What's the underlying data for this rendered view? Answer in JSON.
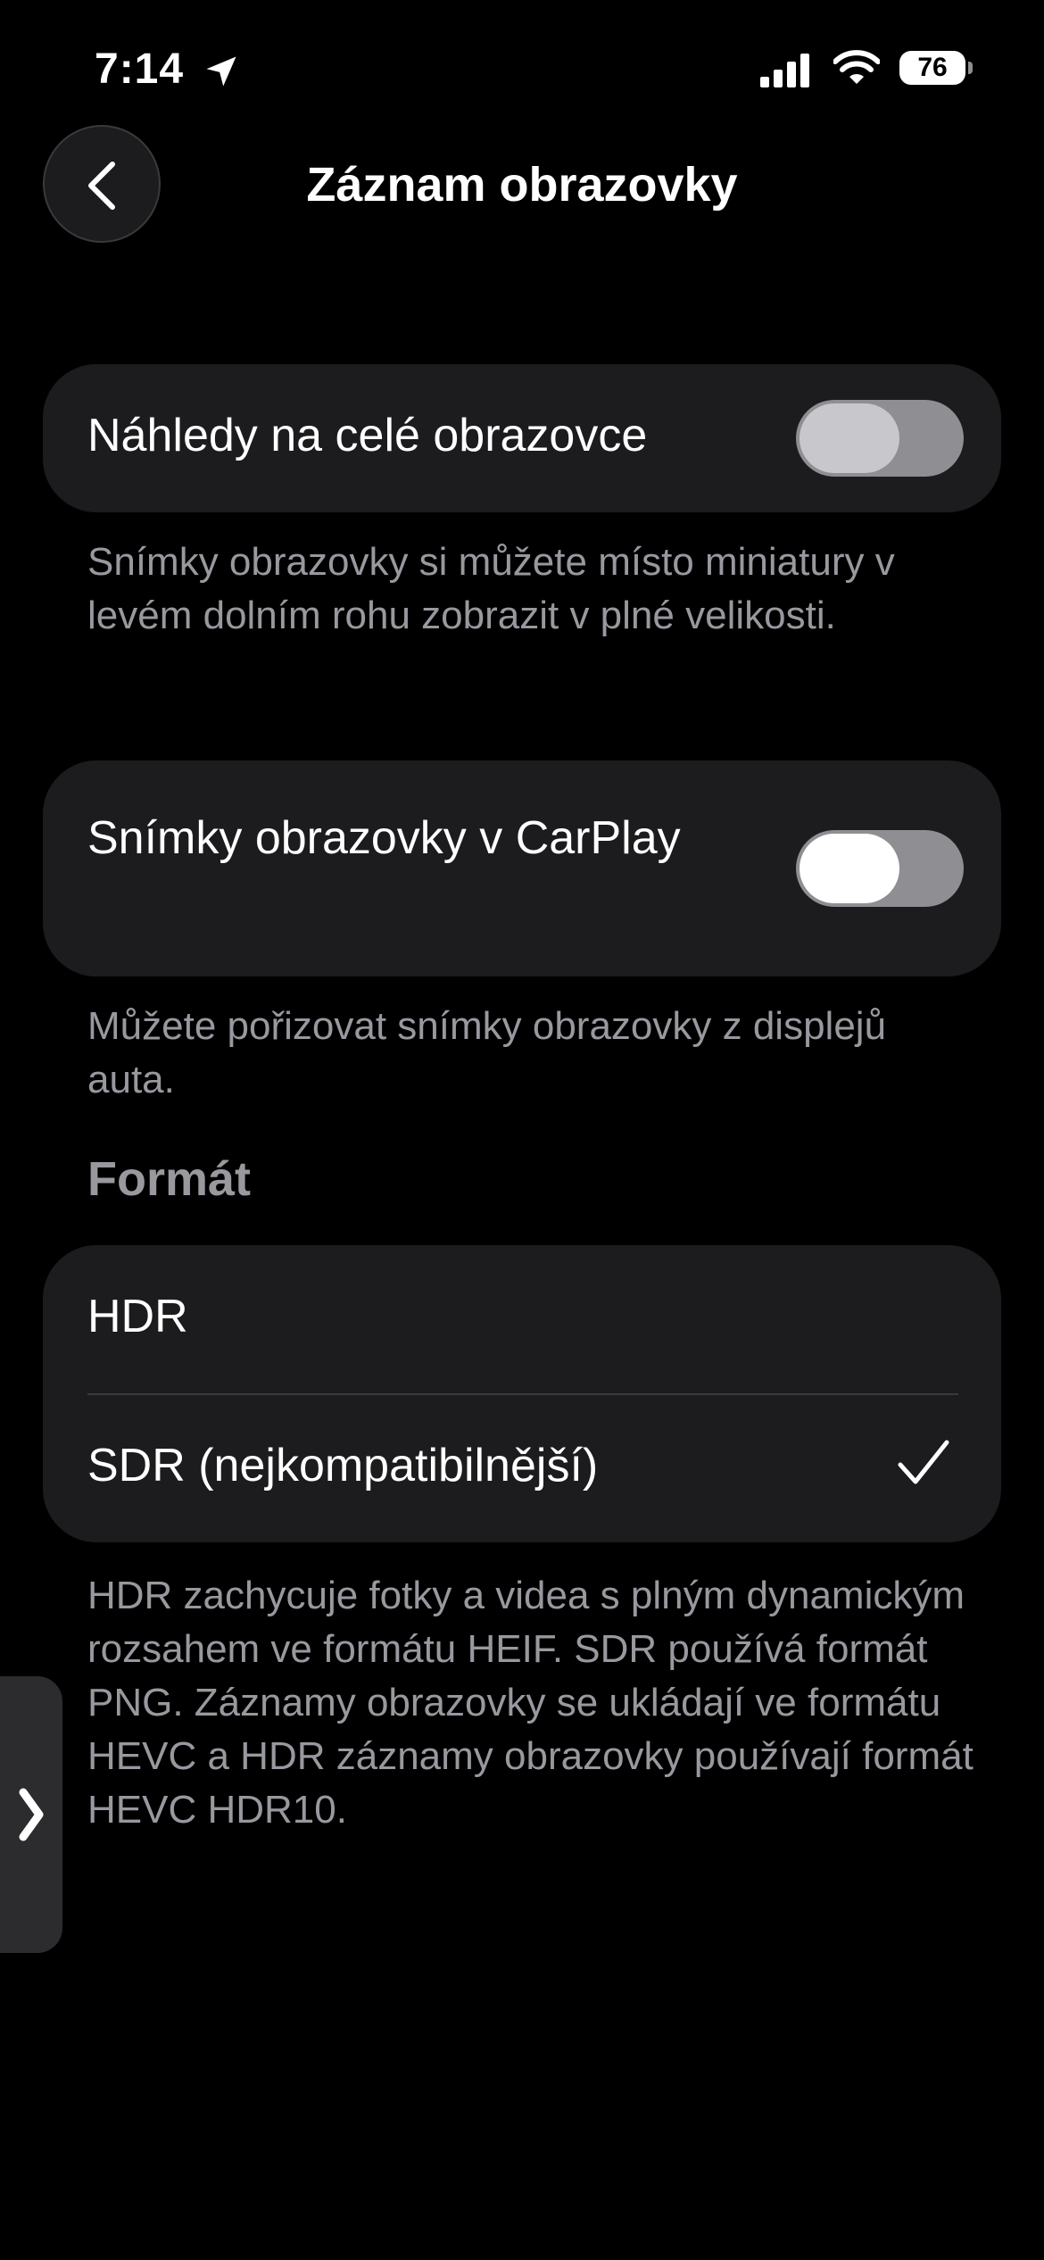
{
  "status_bar": {
    "time": "7:14",
    "battery_level": "76",
    "location_icon": "location-arrow-icon",
    "signal_icon": "cellular-signal-icon",
    "wifi_icon": "wifi-icon"
  },
  "nav": {
    "back_icon": "chevron-left-icon",
    "title": "Záznam obrazovky"
  },
  "settings": {
    "fullscreen_previews": {
      "label": "Náhledy na celé obrazovce",
      "enabled": false,
      "footnote": "Snímky obrazovky si můžete místo miniatury v levém dolním rohu zobrazit v plné velikosti."
    },
    "carplay_screenshots": {
      "label": "Snímky obrazovky v CarPlay",
      "enabled": false,
      "footnote": "Můžete pořizovat snímky obrazovky z displejů auta."
    }
  },
  "format": {
    "header": "Formát",
    "options": [
      {
        "label": "HDR",
        "selected": false
      },
      {
        "label": "SDR (nejkompatibilnější)",
        "selected": true
      }
    ],
    "footnote": "HDR zachycuje fotky a videa s plným dynamickým rozsahem ve formátu HEIF. SDR používá formát PNG. Záznamy obrazovky se ukládají ve formátu HEVC a HDR záznamy obrazovky používají formát HEVC HDR10."
  },
  "edge_handle": {
    "icon": "chevron-right-icon"
  },
  "colors": {
    "background": "#000000",
    "card": "#1c1c1e",
    "secondary_text": "#98989f",
    "toggle_track": "#8e8e93"
  }
}
